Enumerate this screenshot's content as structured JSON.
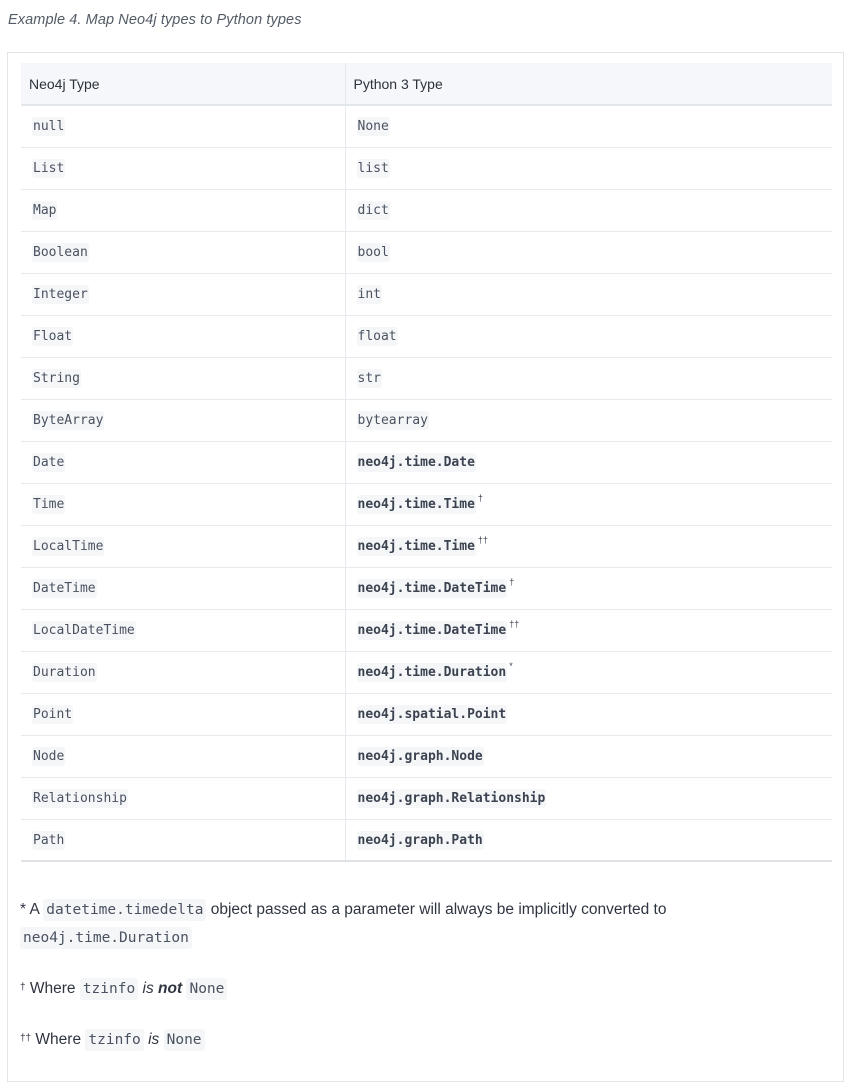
{
  "caption": "Example 4. Map Neo4j types to Python types",
  "table": {
    "headers": [
      "Neo4j Type",
      "Python 3 Type"
    ],
    "rows": [
      {
        "neo4j": "null",
        "python": "None",
        "strong": false,
        "mark": ""
      },
      {
        "neo4j": "List",
        "python": "list",
        "strong": false,
        "mark": ""
      },
      {
        "neo4j": "Map",
        "python": "dict",
        "strong": false,
        "mark": ""
      },
      {
        "neo4j": "Boolean",
        "python": "bool",
        "strong": false,
        "mark": ""
      },
      {
        "neo4j": "Integer",
        "python": "int",
        "strong": false,
        "mark": ""
      },
      {
        "neo4j": "Float",
        "python": "float",
        "strong": false,
        "mark": ""
      },
      {
        "neo4j": "String",
        "python": "str",
        "strong": false,
        "mark": ""
      },
      {
        "neo4j": "ByteArray",
        "python": "bytearray",
        "strong": false,
        "mark": ""
      },
      {
        "neo4j": "Date",
        "python": "neo4j.time.Date",
        "strong": true,
        "mark": ""
      },
      {
        "neo4j": "Time",
        "python": "neo4j.time.Time",
        "strong": true,
        "mark": "†"
      },
      {
        "neo4j": "LocalTime",
        "python": "neo4j.time.Time",
        "strong": true,
        "mark": "††"
      },
      {
        "neo4j": "DateTime",
        "python": "neo4j.time.DateTime",
        "strong": true,
        "mark": "†"
      },
      {
        "neo4j": "LocalDateTime",
        "python": "neo4j.time.DateTime",
        "strong": true,
        "mark": "††"
      },
      {
        "neo4j": "Duration",
        "python": "neo4j.time.Duration",
        "strong": true,
        "mark": "*"
      },
      {
        "neo4j": "Point",
        "python": "neo4j.spatial.Point",
        "strong": true,
        "mark": ""
      },
      {
        "neo4j": "Node",
        "python": "neo4j.graph.Node",
        "strong": true,
        "mark": ""
      },
      {
        "neo4j": "Relationship",
        "python": "neo4j.graph.Relationship",
        "strong": true,
        "mark": ""
      },
      {
        "neo4j": "Path",
        "python": "neo4j.graph.Path",
        "strong": true,
        "mark": ""
      }
    ]
  },
  "notes": {
    "n1": {
      "mark": "*",
      "prefix": " A ",
      "code1": "datetime.timedelta",
      "middle": " object passed as a parameter will always be implicitly converted to",
      "code2": "neo4j.time.Duration"
    },
    "n2": {
      "mark": "†",
      "prefix": " Where ",
      "code1": "tzinfo",
      "em_before": "is",
      "em_strong": "not",
      "code2": "None"
    },
    "n3": {
      "mark": "††",
      "prefix": " Where ",
      "code1": "tzinfo",
      "em": "is",
      "code2": "None"
    }
  }
}
